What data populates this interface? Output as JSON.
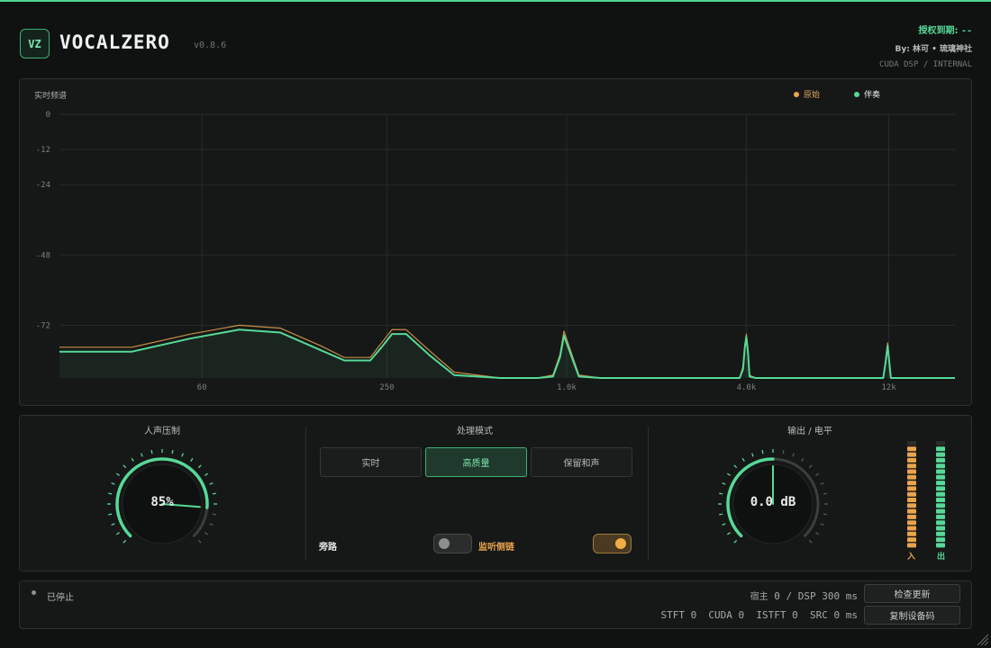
{
  "header": {
    "logo": "VZ",
    "title": "VOCALZERO",
    "version": "v0.8.6",
    "license_label": "授权到期:",
    "license_value": "--",
    "byline": "By: 林可 • 琉璃神社",
    "engine": "CUDA DSP / INTERNAL"
  },
  "spectrum": {
    "title": "实时频谱",
    "legend": [
      {
        "name": "原始",
        "color": "#e9a44c"
      },
      {
        "name": "伴奏",
        "color": "#56d997"
      }
    ]
  },
  "chart_data": {
    "type": "area",
    "ylabel": "",
    "xlabel": "",
    "y_ticks": [
      0,
      -12,
      -24,
      -48,
      -72
    ],
    "x_ticks": [
      "60",
      "250",
      "1.0k",
      "4.0k",
      "12k"
    ],
    "x_tick_values": [
      60,
      250,
      1000,
      4000,
      12000
    ],
    "xlim": [
      20,
      20000
    ],
    "ylim": [
      -90,
      0
    ],
    "x_scale": "log",
    "grid": true,
    "series": [
      {
        "name": "原始",
        "color": "#e9a44c",
        "x": [
          20,
          35,
          55,
          80,
          110,
          150,
          180,
          220,
          240,
          260,
          290,
          350,
          420,
          600,
          800,
          900,
          950,
          980,
          1050,
          1100,
          1300,
          3000,
          3800,
          3900,
          3950,
          4000,
          4050,
          4100,
          4300,
          8000,
          11000,
          11500,
          11700,
          11900,
          12200,
          20000
        ],
        "y": [
          -79.5,
          -79.5,
          -75,
          -72,
          -73,
          -79,
          -83,
          -83,
          -78,
          -73.5,
          -73.5,
          -81,
          -88,
          -90,
          -90,
          -89,
          -82,
          -74,
          -83,
          -89,
          -90,
          -90,
          -90,
          -86,
          -79,
          -75,
          -80,
          -89,
          -90,
          -90,
          -90,
          -90,
          -84,
          -78,
          -90,
          -90
        ]
      },
      {
        "name": "伴奏",
        "color": "#56d997",
        "x": [
          20,
          35,
          55,
          80,
          110,
          150,
          180,
          220,
          240,
          260,
          290,
          350,
          420,
          600,
          800,
          900,
          950,
          980,
          1050,
          1100,
          1300,
          3000,
          3800,
          3900,
          3950,
          4000,
          4050,
          4100,
          4300,
          8000,
          11000,
          11500,
          11700,
          11900,
          12200,
          20000
        ],
        "y": [
          -81,
          -81,
          -76.5,
          -73.5,
          -74.5,
          -80.5,
          -84,
          -84,
          -79.5,
          -75,
          -75,
          -82.5,
          -89,
          -90,
          -90,
          -89.5,
          -83,
          -75.5,
          -84,
          -89.5,
          -90,
          -90,
          -90,
          -87,
          -80,
          -76,
          -81,
          -89.5,
          -90,
          -90,
          -90,
          -90,
          -85,
          -79,
          -90,
          -90
        ]
      }
    ]
  },
  "vocal_suppression": {
    "label": "人声压制",
    "value_text": "85%",
    "value": 0.85
  },
  "processing_mode": {
    "label": "处理模式",
    "options": [
      "实时",
      "高质量",
      "保留和声"
    ],
    "selected": "高质量",
    "bypass_label": "旁路",
    "bypass_on": false,
    "monitor_label": "监听侧链",
    "monitor_on": true
  },
  "output": {
    "label": "输出 / 电平",
    "value_text": "0.0 dB",
    "value": 0.5,
    "in_label": "入",
    "out_label": "出",
    "in_level": 0.97,
    "out_level": 0.93
  },
  "status": {
    "state": "已停止",
    "line1_label": "宿主",
    "line1_value": "0 / DSP 300 ms",
    "line2": "STFT 0  CUDA 0  ISTFT 0  SRC 0 ms",
    "check_update": "检查更新",
    "copy_device_code": "复制设备码"
  },
  "colors": {
    "accent": "#56d997",
    "warm": "#e9a44c"
  }
}
